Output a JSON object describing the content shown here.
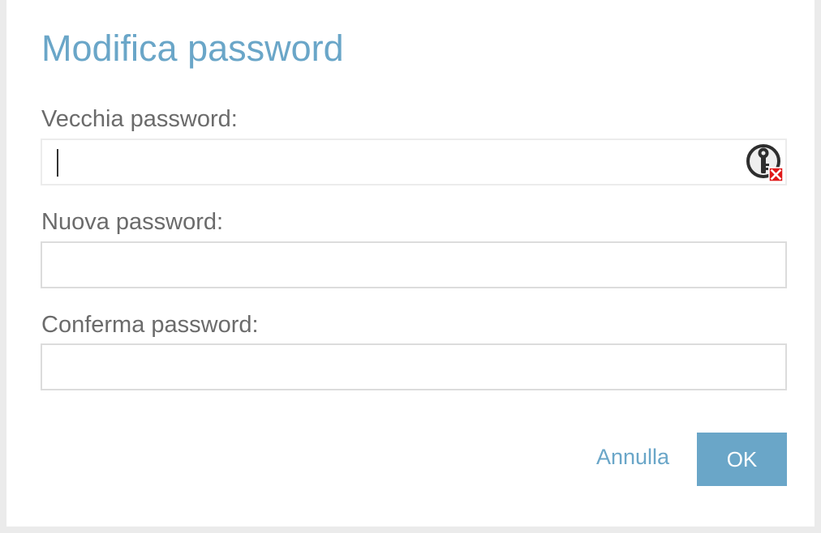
{
  "dialog": {
    "title": "Modifica password",
    "fields": [
      {
        "label": "Vecchia password:",
        "value": "",
        "placeholder": ""
      },
      {
        "label": "Nuova password:",
        "value": "",
        "placeholder": ""
      },
      {
        "label": "Conferma password:",
        "value": "",
        "placeholder": ""
      }
    ],
    "cancel_label": "Annulla",
    "ok_label": "OK"
  },
  "colors": {
    "title": "#6aa6c8",
    "label": "#6b6b6b",
    "accent": "#6aa6c8",
    "field_border": "#dcdcdc",
    "background": "#ebebeb",
    "dialog_bg": "#ffffff"
  },
  "icons": {
    "password_manager": "key-icon",
    "password_manager_badge": "red-x-badge-icon"
  }
}
